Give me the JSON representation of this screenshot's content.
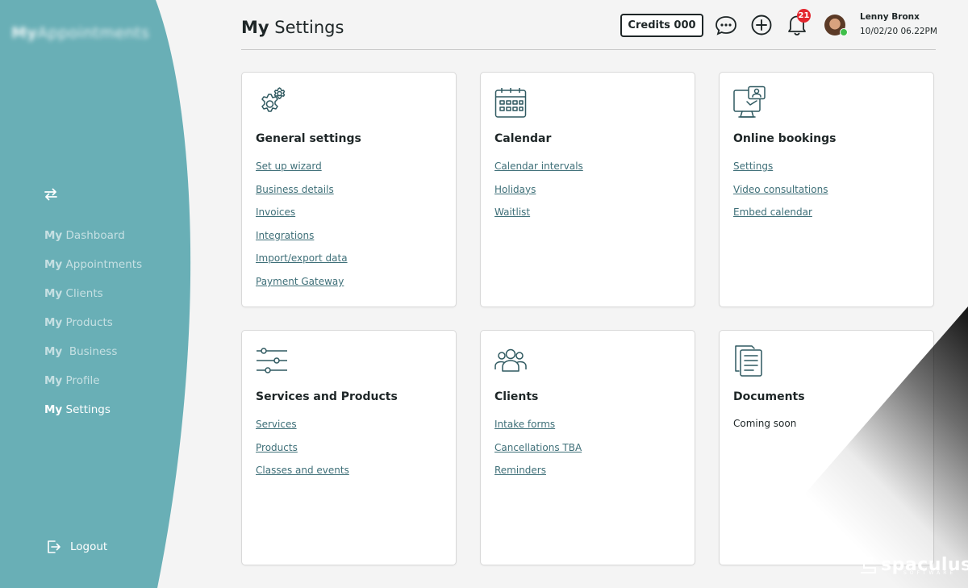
{
  "app": {
    "logo_prefix": "My",
    "logo_text": "Appointments"
  },
  "sidebar": {
    "items": [
      {
        "prefix": "My",
        "label": "Dashboard"
      },
      {
        "prefix": "My",
        "label": "Appointments"
      },
      {
        "prefix": "My",
        "label": "Clients"
      },
      {
        "prefix": "My",
        "label": "Products"
      },
      {
        "prefix": "My",
        "label": " Business"
      },
      {
        "prefix": "My",
        "label": "Profile"
      },
      {
        "prefix": "My",
        "label": "Settings",
        "active": true
      }
    ],
    "logout_label": "Logout"
  },
  "header": {
    "title_prefix": "My",
    "title": "Settings",
    "credits_label": "Credits 000",
    "notification_count": "21",
    "user_name": "Lenny Bronx",
    "timestamp": "10/02/20 06.22PM"
  },
  "cards": [
    {
      "title": "General settings",
      "icon": "gears-icon",
      "links": [
        "Set up wizard",
        "Business details",
        "Invoices",
        "Integrations",
        "Import/export data",
        "Payment Gateway"
      ]
    },
    {
      "title": "Calendar",
      "icon": "calendar-icon",
      "links": [
        "Calendar intervals",
        "Holidays",
        "Waitlist"
      ]
    },
    {
      "title": "Online bookings",
      "icon": "monitor-user-icon",
      "links": [
        "Settings",
        "Video consultations",
        "Embed calendar"
      ]
    },
    {
      "title": "Services and Products",
      "icon": "sliders-icon",
      "links": [
        "Services",
        "Products",
        "Classes and events"
      ]
    },
    {
      "title": "Clients",
      "icon": "users-icon",
      "links": [
        "Intake forms",
        "Cancellations TBA",
        "Reminders"
      ]
    },
    {
      "title": "Documents",
      "icon": "documents-icon",
      "note": "Coming soon"
    }
  ],
  "watermark": {
    "text": "spaculus",
    "sub": "SOFTWARE"
  },
  "colors": {
    "sidebar": "#69afb6",
    "link": "#3e6f78",
    "text": "#1e2627",
    "badge": "#e3262e",
    "background": "#f4f4f4"
  }
}
